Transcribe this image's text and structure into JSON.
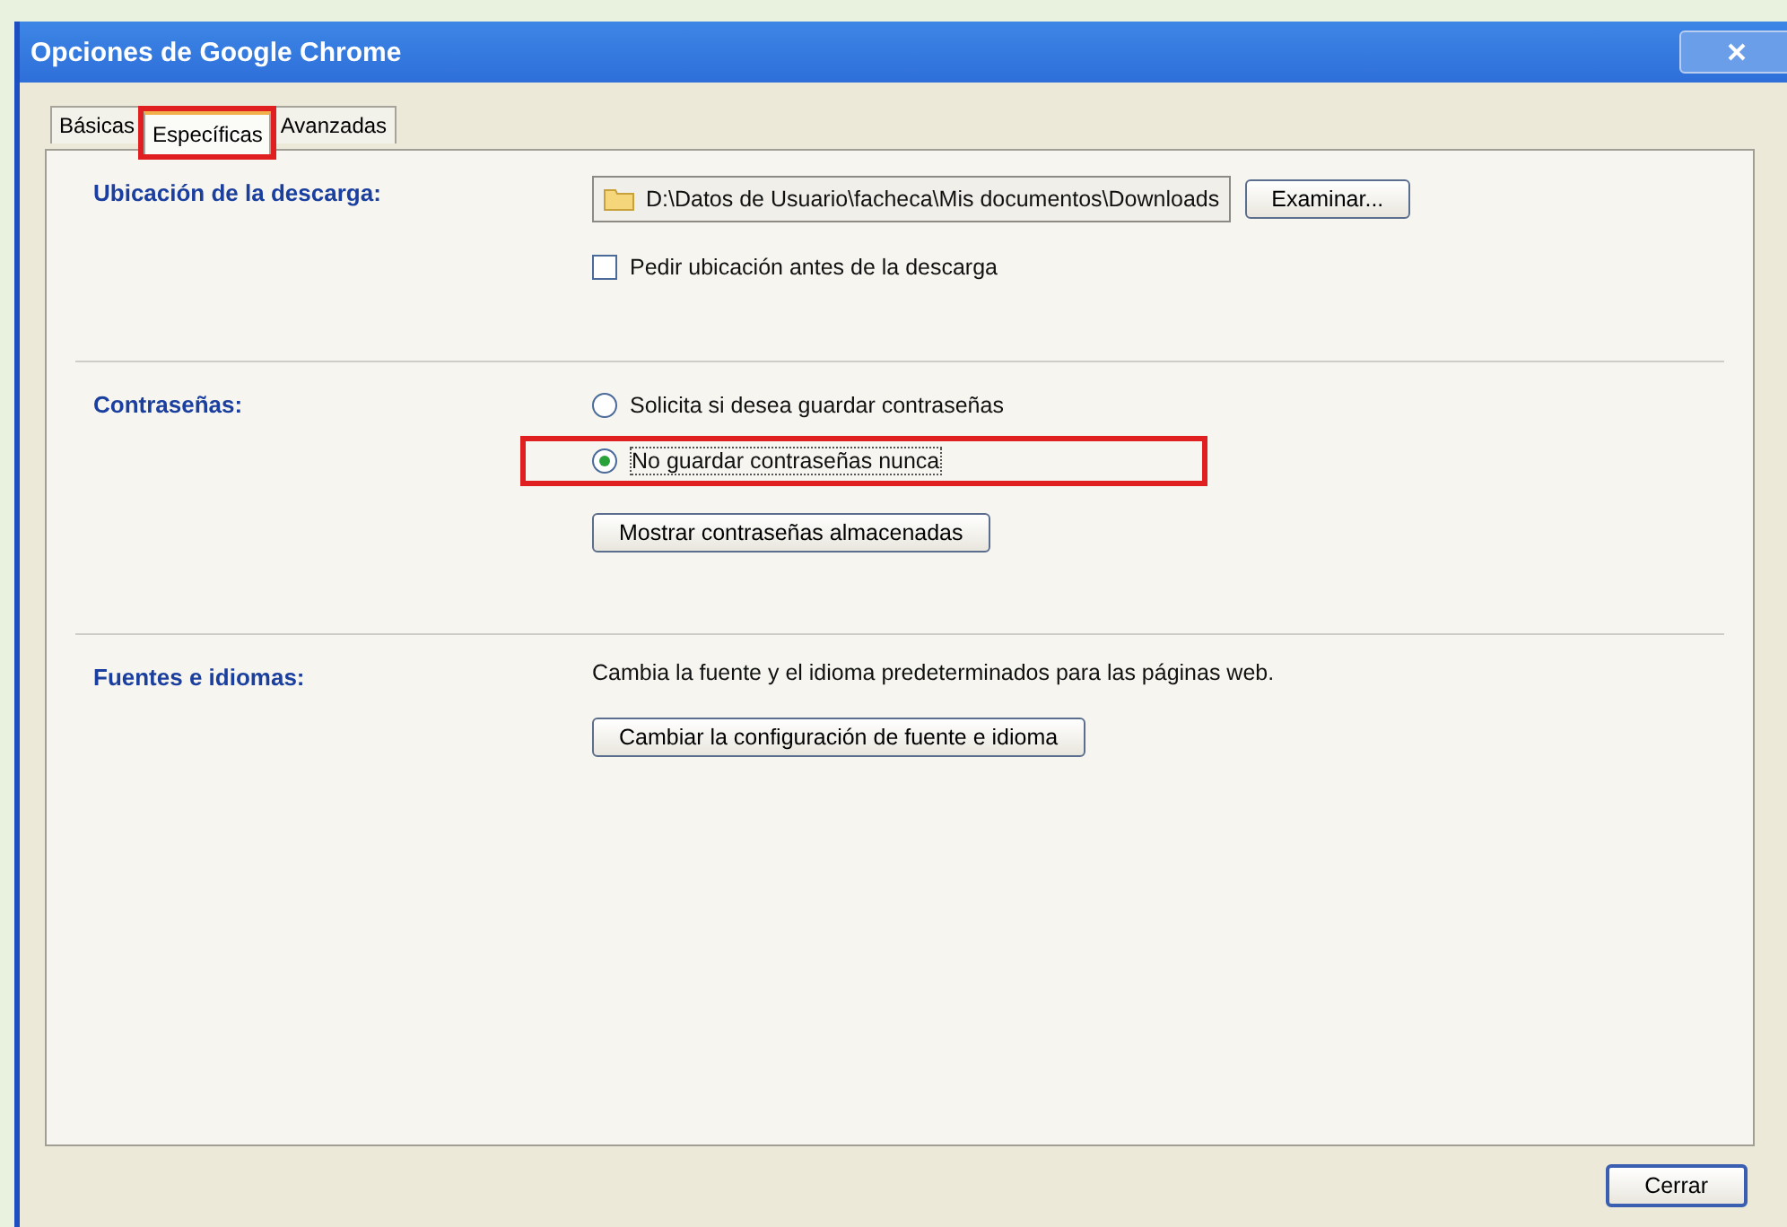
{
  "window": {
    "title": "Opciones de Google Chrome"
  },
  "tabs": [
    {
      "label": "Básicas",
      "selected": false,
      "highlighted": false
    },
    {
      "label": "Específicas",
      "selected": true,
      "highlighted": true
    },
    {
      "label": "Avanzadas",
      "selected": false,
      "highlighted": false
    }
  ],
  "sections": [
    {
      "title": "Ubicación de la descarga:",
      "items": [
        {
          "kind": "path",
          "value": "D:\\Datos de Usuario\\facheca\\Mis documentos\\Downloads",
          "button": "Examinar..."
        },
        {
          "kind": "checkbox",
          "label": "Pedir ubicación antes de la descarga",
          "checked": false
        }
      ]
    },
    {
      "title": "Contraseñas:",
      "items": [
        {
          "kind": "radio",
          "label": "Solicita si desea guardar contraseñas",
          "selected": false,
          "highlighted": false
        },
        {
          "kind": "radio",
          "label": "No guardar contraseñas nunca",
          "selected": true,
          "highlighted": true
        },
        {
          "kind": "button",
          "label": "Mostrar contraseñas almacenadas"
        }
      ]
    },
    {
      "title": "Fuentes e idiomas:",
      "items": [
        {
          "kind": "text",
          "label": "Cambia la fuente y el idioma predeterminados para las páginas web."
        },
        {
          "kind": "button",
          "label": "Cambiar la configuración de fuente e idioma"
        }
      ]
    }
  ],
  "footer": {
    "button": "Cerrar"
  }
}
